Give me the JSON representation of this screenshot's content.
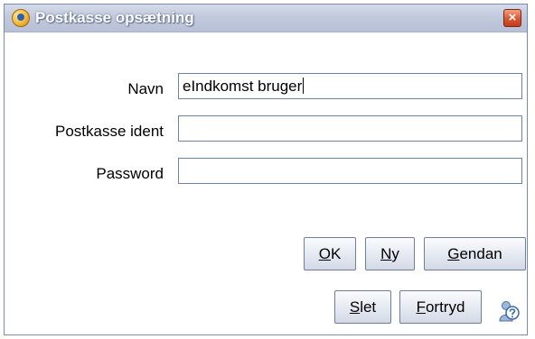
{
  "window": {
    "title": "Postkasse opsætning",
    "close_glyph": "×"
  },
  "form": {
    "name_label": "Navn",
    "name_value": "eIndkomst bruger",
    "ident_label": "Postkasse ident",
    "ident_value": "",
    "password_label": "Password",
    "password_value": ""
  },
  "buttons": {
    "ok": {
      "mnemonic": "O",
      "rest": "K"
    },
    "new": {
      "mnemonic": "N",
      "rest": "y"
    },
    "restore": {
      "mnemonic": "G",
      "rest": "endan"
    },
    "delete": {
      "mnemonic": "S",
      "rest": "let"
    },
    "cancel": {
      "mnemonic": "F",
      "rest": "ortryd"
    }
  },
  "icons": {
    "app": "mailbox-app-icon",
    "close": "close-icon",
    "help": "help-icon"
  },
  "colors": {
    "titlebar": "#c1c9dc",
    "close_button": "#d9552f",
    "field_border": "#6d83a8",
    "button_border": "#6e7f9e"
  }
}
